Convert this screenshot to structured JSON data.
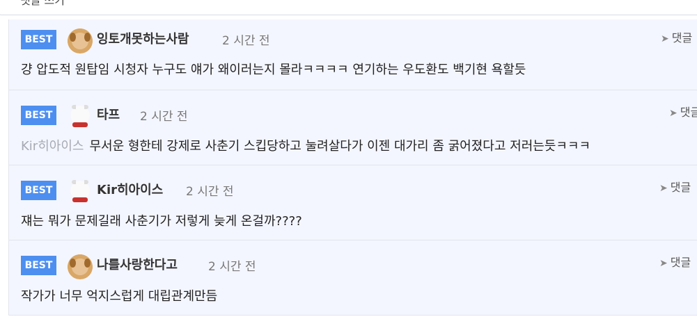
{
  "reply_input": {
    "placeholder": "댓글 쓰기"
  },
  "comments": [
    {
      "badge": "BEST",
      "nick": "잉토개못하는사람",
      "time": "2 시간 전",
      "reply": "댓글",
      "mention": "",
      "text": "걍 압도적 원탑임 시청자 누구도 얘가 왜이러는지 몰라ㅋㅋㅋㅋ 연기하는 우도환도 백기현 욕할듯",
      "avatar": "puppy-avatar"
    },
    {
      "badge": "BEST",
      "nick": "타프",
      "time": "2 시간 전",
      "reply": "댓글",
      "mention": "Kir히아이스",
      "text": "무서운 형한테 강제로 사춘기 스킵당하고 눌려살다가 이젠 대가리 좀 굵어졌다고 저러는듯ㅋㅋㅋ",
      "avatar": "polar-bear-avatar"
    },
    {
      "badge": "BEST",
      "nick": "Kir히아이스",
      "time": "2 시간 전",
      "reply": "댓글",
      "mention": "",
      "text": "쟤는 뭐가 문제길래 사춘기가 저렇게 늦게 온걸까????",
      "avatar": "polar-bear-avatar"
    },
    {
      "badge": "BEST",
      "nick": "나를사랑한다고",
      "time": "2 시간 전",
      "reply": "댓글",
      "mention": "",
      "text": "작가가 너무 억지스럽게 대립관계만듬",
      "avatar": "puppy-avatar"
    }
  ]
}
